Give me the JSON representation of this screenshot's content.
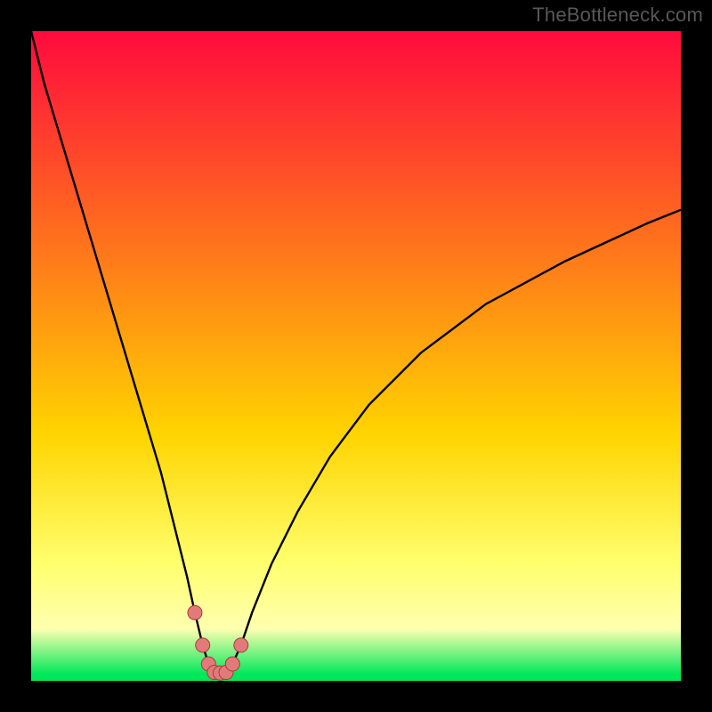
{
  "watermark": "TheBottleneck.com",
  "colors": {
    "bg_black": "#000000",
    "grad_top": "#ff0a3d",
    "grad_mid1": "#ff7a1a",
    "grad_mid2": "#ffd400",
    "grad_mid3": "#ffff6e",
    "grad_light": "#ffffb0",
    "grad_green": "#00e85a",
    "stroke": "#000000",
    "marker_fill": "#e27a7a",
    "marker_stroke": "#aa3b3b"
  },
  "chart_data": {
    "type": "line",
    "title": "",
    "xlabel": "",
    "ylabel": "",
    "xlim": [
      0,
      100
    ],
    "ylim": [
      0,
      100
    ],
    "series": [
      {
        "name": "curve",
        "x": [
          0,
          2,
          5,
          8,
          11,
          14,
          17,
          20,
          22,
          24,
          25.2,
          26.4,
          27.3,
          28.2,
          29.1,
          30,
          31,
          32.3,
          34,
          37,
          41,
          46,
          52,
          60,
          70,
          82,
          95,
          100
        ],
        "y": [
          100,
          92,
          82,
          72,
          62,
          52,
          42,
          32,
          24,
          16,
          10.5,
          5.5,
          2.6,
          1.3,
          1.2,
          1.3,
          2.6,
          5.5,
          10.5,
          18,
          26,
          34.5,
          42.5,
          50.5,
          58,
          64.5,
          70.5,
          72.5
        ]
      }
    ],
    "markers": {
      "name": "bottleneck-points",
      "x": [
        25.2,
        26.4,
        27.3,
        28.2,
        29.1,
        30.0,
        31.0,
        32.3
      ],
      "y": [
        10.5,
        5.5,
        2.6,
        1.3,
        1.2,
        1.3,
        2.6,
        5.5
      ]
    },
    "gradient_stops": [
      {
        "offset": 0,
        "color_key": "grad_top"
      },
      {
        "offset": 35,
        "color_key": "grad_mid1"
      },
      {
        "offset": 62,
        "color_key": "grad_mid2"
      },
      {
        "offset": 82,
        "color_key": "grad_mid3"
      },
      {
        "offset": 92,
        "color_key": "grad_light"
      },
      {
        "offset": 99,
        "color_key": "grad_green"
      },
      {
        "offset": 100,
        "color_key": "grad_green"
      }
    ]
  }
}
